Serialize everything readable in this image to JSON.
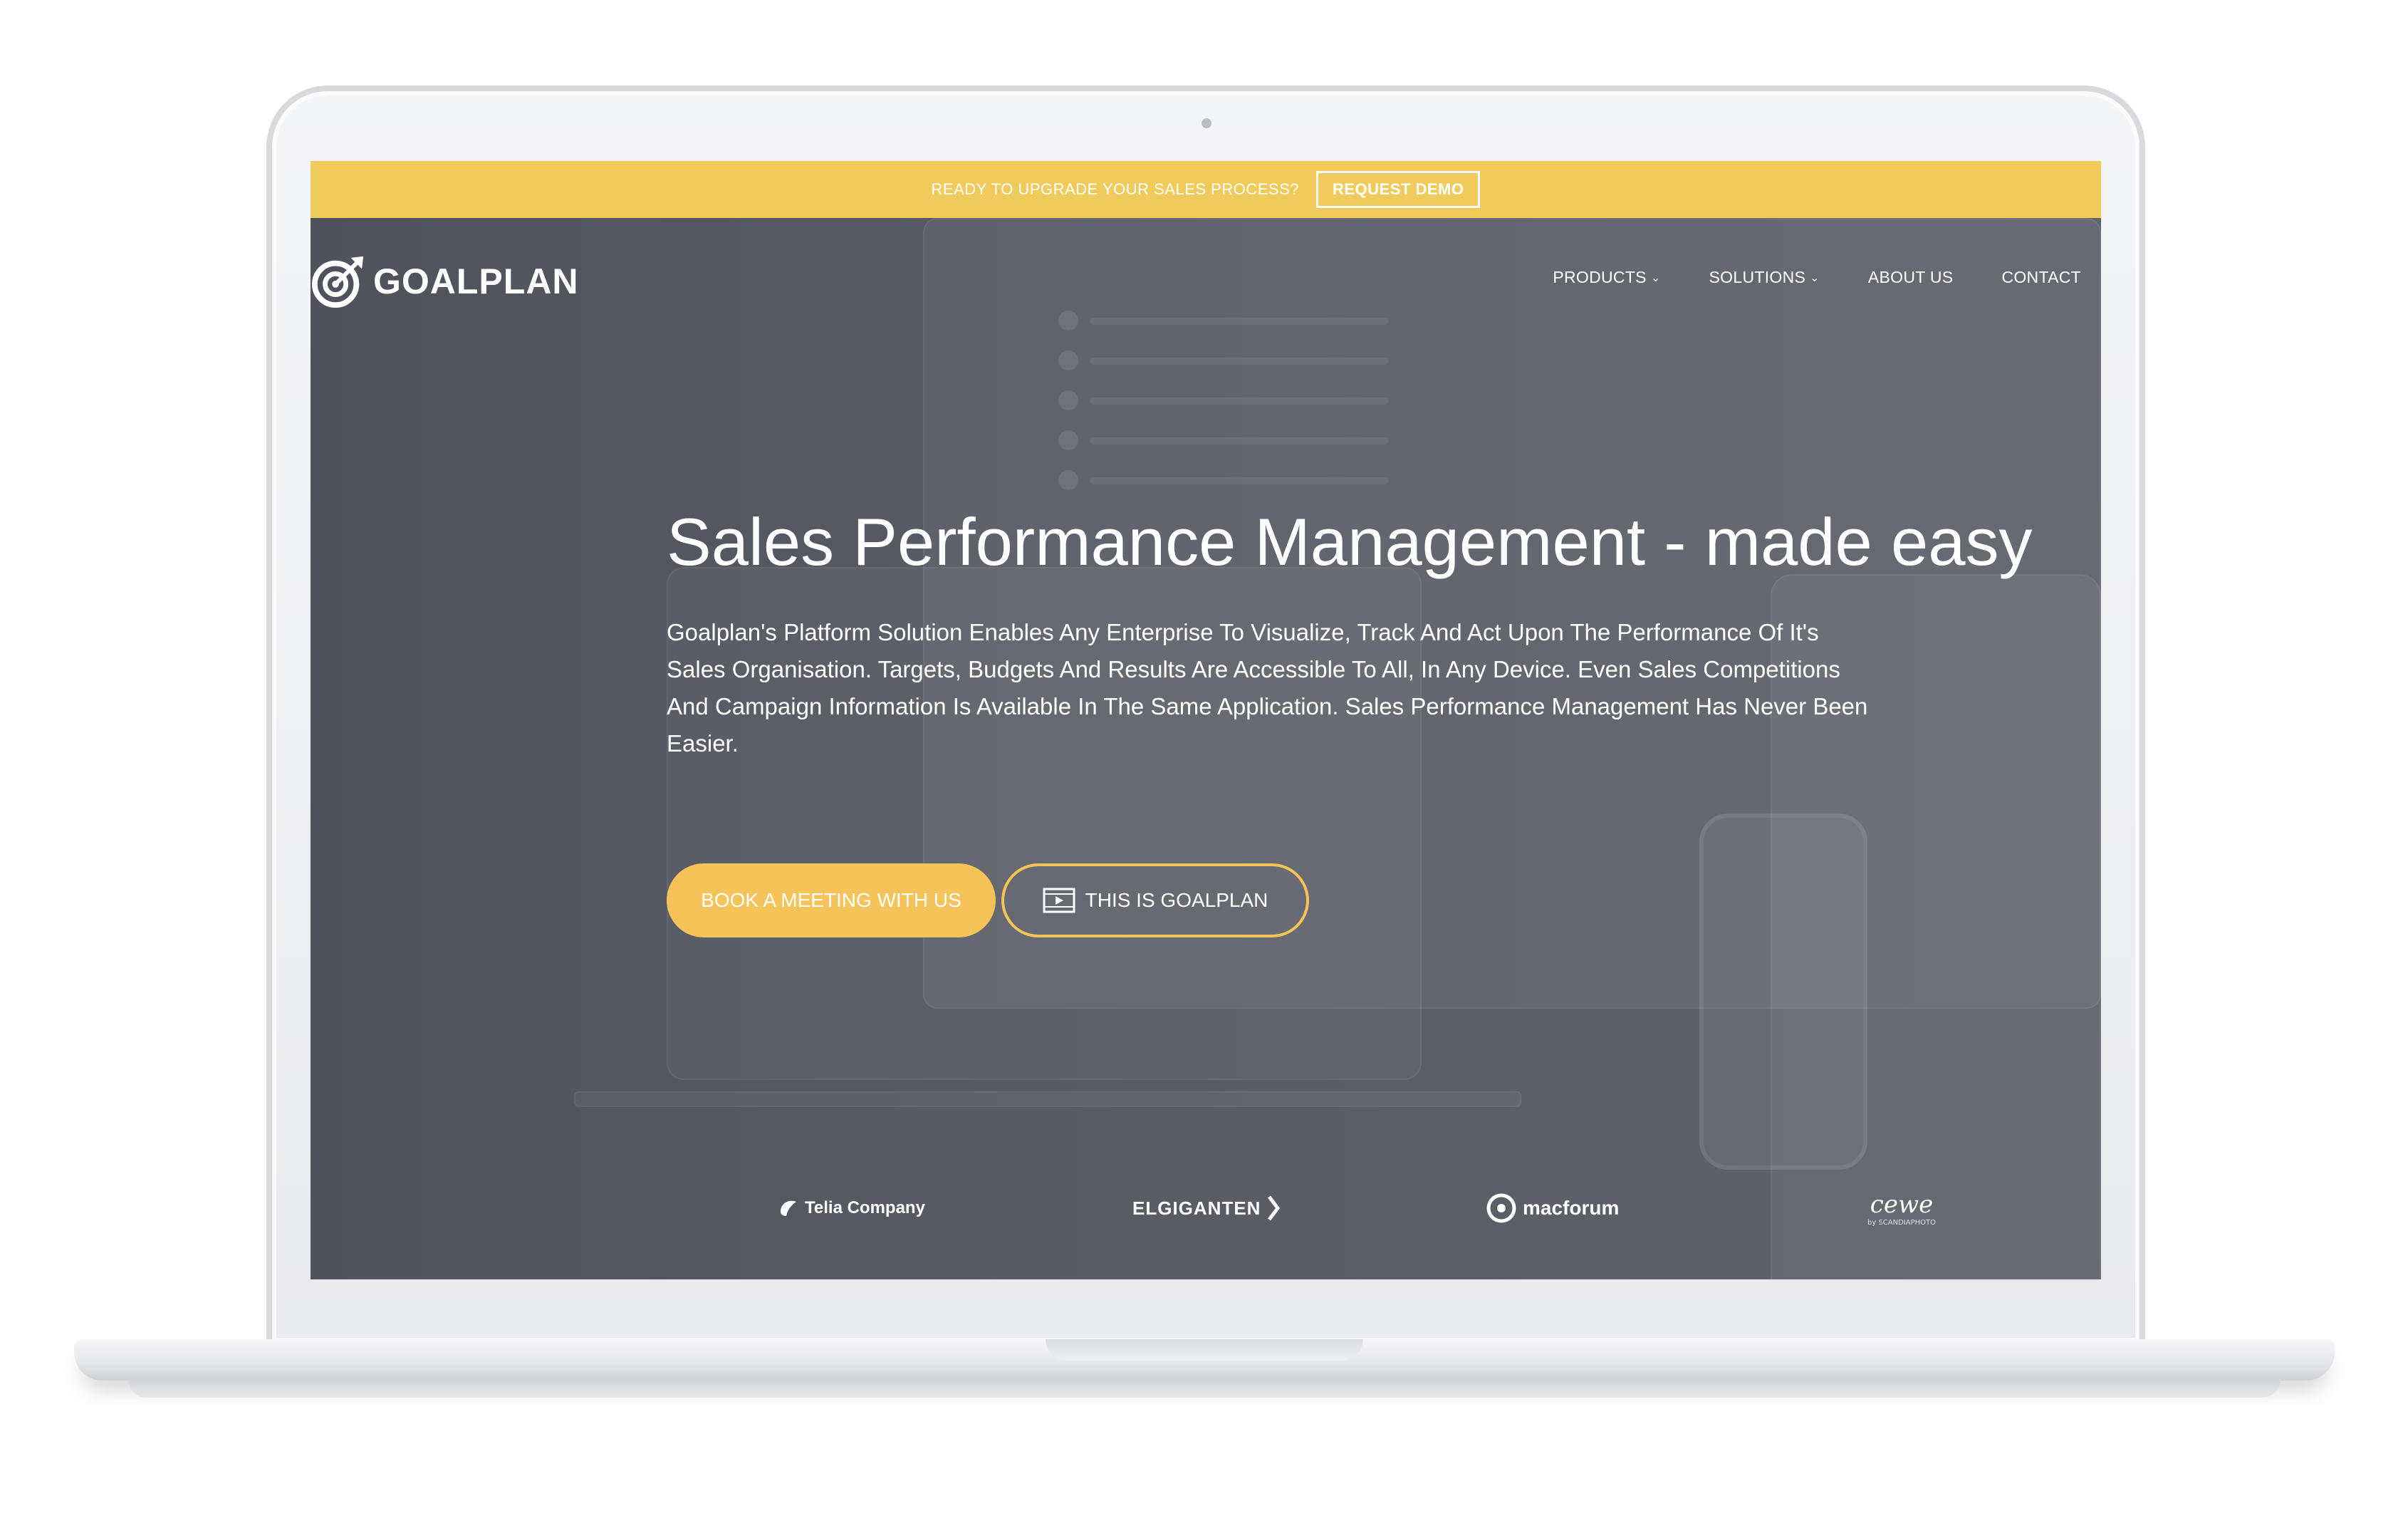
{
  "banner": {
    "text": "READY TO UPGRADE YOUR SALES PROCESS?",
    "button_label": "REQUEST DEMO"
  },
  "logo": {
    "text": "GOALPLAN"
  },
  "nav": {
    "items": [
      {
        "label": "PRODUCTS",
        "has_dropdown": true
      },
      {
        "label": "SOLUTIONS",
        "has_dropdown": true
      },
      {
        "label": "ABOUT US",
        "has_dropdown": false
      },
      {
        "label": "CONTACT",
        "has_dropdown": false
      }
    ]
  },
  "hero": {
    "title": "Sales Performance Management - made easy",
    "description": "Goalplan's Platform Solution Enables Any Enterprise To Visualize, Track And Act Upon The Performance Of It's Sales Organisation. Targets, Budgets And Results Are Accessible To All, In Any Device. Even Sales Competitions And Campaign Information Is Available In The Same Application. Sales Performance Management Has Never Been Easier.",
    "primary_button": "BOOK A MEETING WITH US",
    "secondary_button": "THIS IS GOALPLAN"
  },
  "clients": {
    "telia": "Telia Company",
    "elgiganten": "ELGIGANTEN",
    "macforum": "macforum",
    "cewe": "cewe",
    "cewe_sub": "by SCANDIAPHOTO"
  },
  "colors": {
    "accent": "#f5c35a",
    "banner": "#f1ca5c",
    "hero_bg": "#575a63"
  },
  "icons": {
    "logo": "target-arrow-icon",
    "video": "film-icon",
    "dropdown": "chevron-down-icon"
  }
}
